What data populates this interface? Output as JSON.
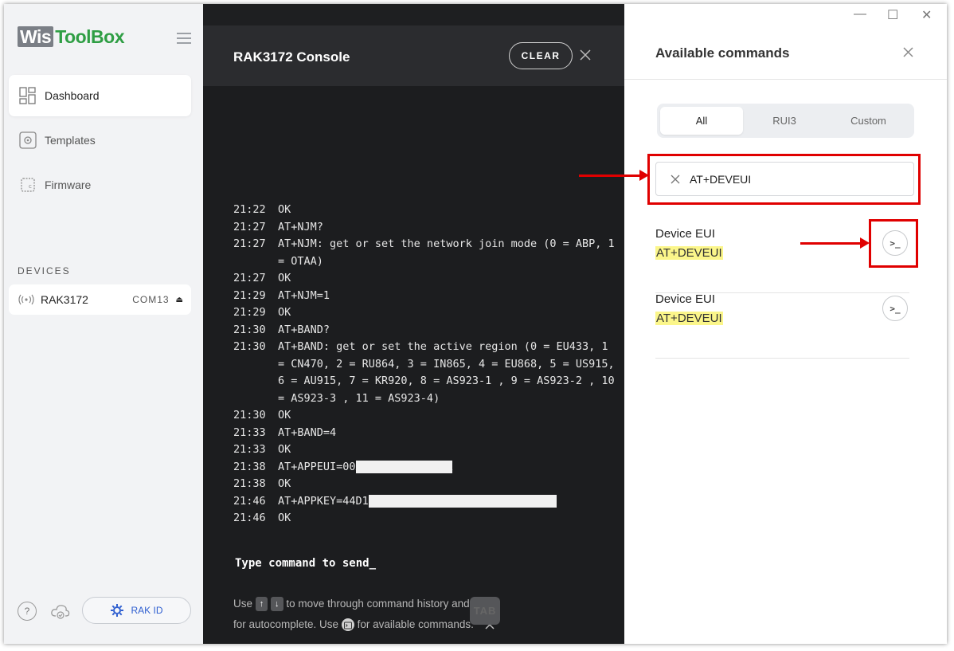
{
  "app": {
    "logo_wis": "Wis",
    "logo_toolbox": "ToolBox"
  },
  "sidebar": {
    "items": [
      {
        "label": "Dashboard",
        "icon": "dashboard-icon",
        "active": true
      },
      {
        "label": "Templates",
        "icon": "templates-icon",
        "active": false
      },
      {
        "label": "Firmware",
        "icon": "firmware-icon",
        "active": false
      }
    ],
    "devices_title": "DEVICES",
    "device": {
      "name": "RAK3172",
      "port": "COM13",
      "eject": "⏏"
    },
    "help_label": "?",
    "rak_id_label": "RAK ID"
  },
  "console": {
    "title": "RAK3172 Console",
    "clear_label": "CLEAR",
    "log": [
      {
        "time": "21:22",
        "msg": "OK"
      },
      {
        "time": "21:27",
        "msg": "AT+NJM?"
      },
      {
        "time": "21:27",
        "msg": "AT+NJM: get or set the network join mode (0 = ABP, 1 = OTAA)"
      },
      {
        "time": "21:27",
        "msg": "OK"
      },
      {
        "time": "21:29",
        "msg": "AT+NJM=1"
      },
      {
        "time": "21:29",
        "msg": "OK"
      },
      {
        "time": "21:30",
        "msg": "AT+BAND?"
      },
      {
        "time": "21:30",
        "msg": "AT+BAND: get or set the active region (0 = EU433, 1 = CN470, 2 = RU864, 3 = IN865, 4 = EU868, 5 = US915, 6 = AU915, 7 = KR920, 8 = AS923-1 , 9 = AS923-2 , 10 = AS923-3 , 11 = AS923-4)"
      },
      {
        "time": "21:30",
        "msg": "OK"
      },
      {
        "time": "21:33",
        "msg": "AT+BAND=4"
      },
      {
        "time": "21:33",
        "msg": "OK"
      },
      {
        "time": "21:38",
        "msg": "AT+APPEUI=00",
        "redacted": "XXXXXXXXXXXXXXX"
      },
      {
        "time": "21:38",
        "msg": "OK"
      },
      {
        "time": "21:46",
        "msg": "AT+APPKEY=44D1",
        "redacted": "XXXXXXXXXXXXXXXXXXXXXXXXXXXXX"
      },
      {
        "time": "21:46",
        "msg": "OK"
      }
    ],
    "prompt": "Type command to send_",
    "hint": {
      "use": "Use",
      "up": "↑",
      "down": "↓",
      "move_text": "to move through command history and",
      "tab": "TAB",
      "for_autocomplete": "for autocomplete. Use",
      "for_available": "for available commands."
    }
  },
  "panel": {
    "title": "Available commands",
    "tabs": [
      {
        "label": "All",
        "active": true
      },
      {
        "label": "RUI3",
        "active": false
      },
      {
        "label": "Custom",
        "active": false
      }
    ],
    "search_value": "AT+DEVEUI",
    "commands": [
      {
        "name": "Device EUI",
        "code": "AT+DEVEUI",
        "run_label": ">_"
      },
      {
        "name": "Device EUI",
        "code": "AT+DEVEUI",
        "run_label": ">_"
      }
    ]
  },
  "window_controls": {
    "minimize": "—",
    "maximize": "☐",
    "close": "✕"
  },
  "colors": {
    "accent_green": "#2f9e44",
    "console_bg": "#1c1d1f",
    "highlight_red": "#e00000",
    "match_yellow": "#fbf68a",
    "rak_blue": "#2f5fd0"
  }
}
